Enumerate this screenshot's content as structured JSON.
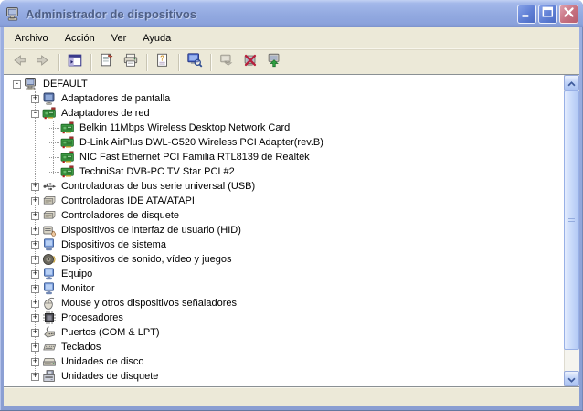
{
  "window": {
    "title": "Administrador de dispositivos",
    "icon": "device-manager-icon",
    "controls": [
      {
        "name": "minimize",
        "icon": "minimize-icon"
      },
      {
        "name": "maximize",
        "icon": "maximize-icon"
      },
      {
        "name": "close",
        "icon": "close-icon"
      }
    ],
    "colors": {
      "titlebar_top": "#b0c2ee",
      "titlebar_bottom": "#8ba2dc",
      "frame": "#93a6d6",
      "chrome_bg": "#ece9d8",
      "content_bg": "#ffffff",
      "close_button": "#c4707f",
      "title_text": "#4e5f86"
    }
  },
  "menubar": {
    "items": [
      {
        "label": "Archivo"
      },
      {
        "label": "Acción"
      },
      {
        "label": "Ver"
      },
      {
        "label": "Ayuda"
      }
    ]
  },
  "toolbar": {
    "items": [
      {
        "type": "button",
        "icon": "back-icon",
        "enabled": false
      },
      {
        "type": "button",
        "icon": "forward-icon",
        "enabled": false
      },
      {
        "type": "separator"
      },
      {
        "type": "button",
        "icon": "console-tree-icon",
        "enabled": true
      },
      {
        "type": "separator"
      },
      {
        "type": "button",
        "icon": "properties-icon",
        "enabled": true
      },
      {
        "type": "button",
        "icon": "print-icon",
        "enabled": true
      },
      {
        "type": "separator"
      },
      {
        "type": "button",
        "icon": "help-icon",
        "enabled": true
      },
      {
        "type": "separator"
      },
      {
        "type": "button",
        "icon": "scan-hardware-icon",
        "enabled": true
      },
      {
        "type": "separator"
      },
      {
        "type": "button",
        "icon": "update-driver-icon",
        "enabled": false
      },
      {
        "type": "button",
        "icon": "uninstall-icon",
        "enabled": true
      },
      {
        "type": "button",
        "icon": "enable-device-icon",
        "enabled": true
      }
    ]
  },
  "tree": {
    "rows": [
      {
        "label": "DEFAULT",
        "level": 0,
        "expander": "-",
        "icon": "computer-icon"
      },
      {
        "label": "Adaptadores de pantalla",
        "level": 1,
        "expander": "+",
        "icon": "display-adapter-icon"
      },
      {
        "label": "Adaptadores de red",
        "level": 1,
        "expander": "-",
        "icon": "network-adapter-icon"
      },
      {
        "label": "Belkin 11Mbps Wireless Desktop Network Card",
        "level": 2,
        "expander": "",
        "icon": "network-adapter-icon"
      },
      {
        "label": "D-Link AirPlus DWL-G520 Wireless PCI Adapter(rev.B)",
        "level": 2,
        "expander": "",
        "icon": "network-adapter-icon"
      },
      {
        "label": "NIC Fast Ethernet PCI Familia RTL8139 de Realtek",
        "level": 2,
        "expander": "",
        "icon": "network-adapter-icon"
      },
      {
        "label": "TechniSat DVB-PC TV Star PCI #2",
        "level": 2,
        "expander": "",
        "icon": "network-adapter-icon"
      },
      {
        "label": "Controladoras de bus serie universal (USB)",
        "level": 1,
        "expander": "+",
        "icon": "usb-icon"
      },
      {
        "label": "Controladoras IDE ATA/ATAPI",
        "level": 1,
        "expander": "+",
        "icon": "ide-controller-icon"
      },
      {
        "label": "Controladores de disquete",
        "level": 1,
        "expander": "+",
        "icon": "floppy-controller-icon"
      },
      {
        "label": "Dispositivos de interfaz de usuario (HID)",
        "level": 1,
        "expander": "+",
        "icon": "hid-icon"
      },
      {
        "label": "Dispositivos de sistema",
        "level": 1,
        "expander": "+",
        "icon": "system-device-icon"
      },
      {
        "label": "Dispositivos de sonido, vídeo y juegos",
        "level": 1,
        "expander": "+",
        "icon": "sound-icon"
      },
      {
        "label": "Equipo",
        "level": 1,
        "expander": "+",
        "icon": "computer-device-icon"
      },
      {
        "label": "Monitor",
        "level": 1,
        "expander": "+",
        "icon": "monitor-icon"
      },
      {
        "label": "Mouse y otros dispositivos señaladores",
        "level": 1,
        "expander": "+",
        "icon": "mouse-icon"
      },
      {
        "label": "Procesadores",
        "level": 1,
        "expander": "+",
        "icon": "processor-icon"
      },
      {
        "label": "Puertos (COM & LPT)",
        "level": 1,
        "expander": "+",
        "icon": "port-icon"
      },
      {
        "label": "Teclados",
        "level": 1,
        "expander": "+",
        "icon": "keyboard-icon"
      },
      {
        "label": "Unidades de disco",
        "level": 1,
        "expander": "+",
        "icon": "disk-drive-icon"
      },
      {
        "label": "Unidades de disquete",
        "level": 1,
        "expander": "+",
        "icon": "floppy-drive-icon"
      }
    ]
  },
  "scrollbar": {
    "orientation": "vertical",
    "up_icon": "scroll-up-icon",
    "down_icon": "scroll-down-icon"
  }
}
